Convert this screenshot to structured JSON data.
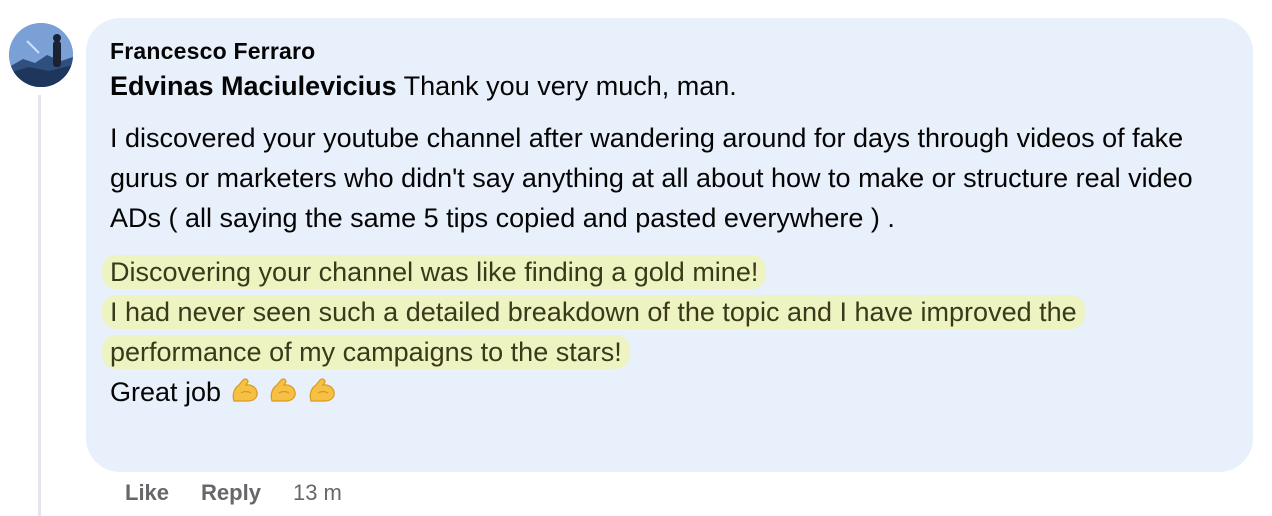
{
  "comment": {
    "author": "Francesco Ferraro",
    "mention": "Edvinas Maciulevicius",
    "first_line": " Thank you very much, man.",
    "paragraph1": "I discovered your youtube channel after wandering around for days through videos of fake gurus or marketers who didn't say anything at all about how to make or structure real video ADs ( all saying the same 5 tips copied and pasted everywhere ) .",
    "highlight_line1": "Discovering your channel was like finding a gold mine!",
    "highlight_line2": "I had never seen such a detailed breakdown of the topic and I have improved the performance of my campaigns to the stars!",
    "closing": "Great job ",
    "emoji": [
      "flexed-biceps-icon",
      "flexed-biceps-icon",
      "flexed-biceps-icon"
    ]
  },
  "actions": {
    "like": "Like",
    "reply": "Reply",
    "timestamp": "13 m"
  },
  "colors": {
    "bubble": "#e7f0fb",
    "highlight": "#eef3c2",
    "muted": "#65676b"
  }
}
